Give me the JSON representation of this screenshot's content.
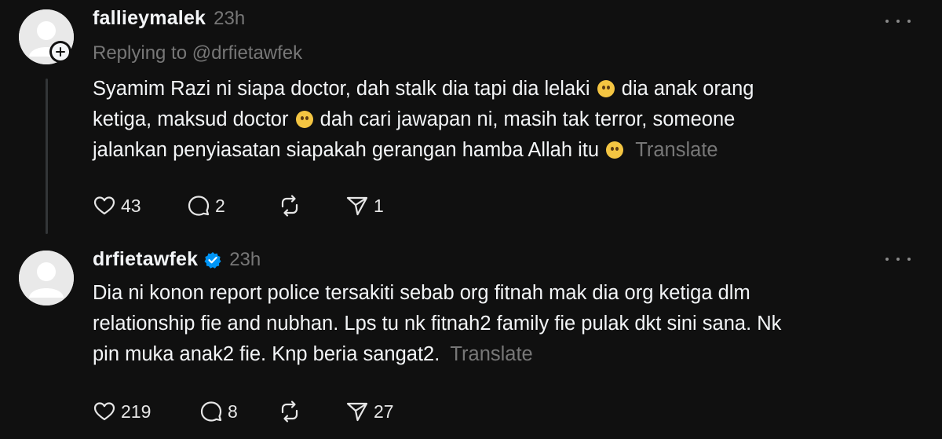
{
  "posts": [
    {
      "username": "fallieymalek",
      "time": "23h",
      "verified": false,
      "replying_to": "Replying to @drfietawfek",
      "text_segments": [
        "Syamim Razi ni siapa doctor, dah stalk dia tapi dia lelaki",
        "dia anak orang",
        "ketiga, maksud doctor",
        "dah cari jawapan ni, masih tak terror, someone",
        "jalankan penyiasatan siapakah gerangan hamba Allah itu"
      ],
      "emojis": [
        "pleading-face-emoji",
        "sad-tear-face-emoji",
        "raised-eyebrow-face-emoji"
      ],
      "translate_label": "Translate",
      "likes": "43",
      "replies": "2",
      "reposts": "",
      "shares": "1"
    },
    {
      "username": "drfietawfek",
      "time": "23h",
      "verified": true,
      "text_lines": [
        "Dia ni konon report police tersakiti sebab org fitnah mak dia org ketiga dlm",
        "relationship fie and nubhan. Lps tu nk fitnah2 family fie pulak dkt sini sana. Nk",
        "pin muka anak2 fie. Knp beria sangat2."
      ],
      "translate_label": "Translate",
      "likes": "219",
      "replies": "8",
      "reposts": "",
      "shares": "27"
    }
  ],
  "colors": {
    "background": "#101010",
    "primary_text": "#f3f5f7",
    "secondary_text": "#777777",
    "verified_blue": "#0095f6",
    "thread_line": "#333638"
  }
}
